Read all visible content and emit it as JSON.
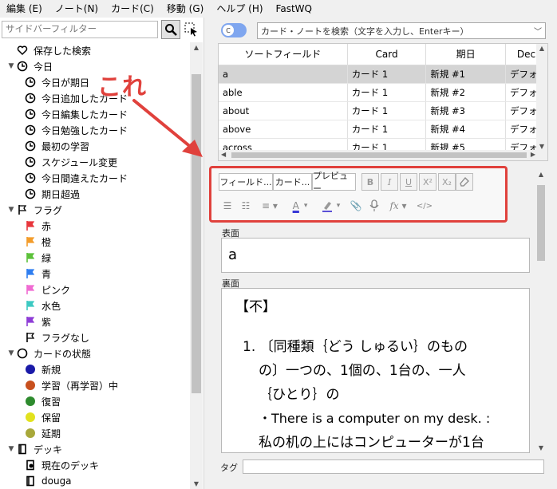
{
  "menu": [
    "編集 (E)",
    "ノート(N)",
    "カード(C)",
    "移動 (G)",
    "ヘルプ (H)",
    "FastWQ"
  ],
  "sidebar": {
    "filter_placeholder": "サイドバーフィルター",
    "items": [
      {
        "label": "保存した検索",
        "icon": "heart-icon"
      },
      {
        "label": "今日",
        "icon": "clock-icon"
      },
      {
        "label": "今日が期日",
        "icon": "clock-icon"
      },
      {
        "label": "今日追加したカード",
        "icon": "clock-icon"
      },
      {
        "label": "今日編集したカード",
        "icon": "clock-icon"
      },
      {
        "label": "今日勉強したカード",
        "icon": "clock-icon"
      },
      {
        "label": "最初の学習",
        "icon": "clock-icon"
      },
      {
        "label": "スケジュール変更",
        "icon": "clock-icon"
      },
      {
        "label": "今日間違えたカード",
        "icon": "clock-icon"
      },
      {
        "label": "期日超過",
        "icon": "clock-icon"
      },
      {
        "label": "フラグ",
        "icon": "flag-icon"
      },
      {
        "label": "赤",
        "icon": "flag-red-icon",
        "color": "#e8363c"
      },
      {
        "label": "橙",
        "icon": "flag-orange-icon",
        "color": "#f39c2a"
      },
      {
        "label": "緑",
        "icon": "flag-green-icon",
        "color": "#5cc13a"
      },
      {
        "label": "青",
        "icon": "flag-blue-icon",
        "color": "#2f7ef0"
      },
      {
        "label": "ピンク",
        "icon": "flag-pink-icon",
        "color": "#f06bd2"
      },
      {
        "label": "水色",
        "icon": "flag-turquoise-icon",
        "color": "#3cc9c2"
      },
      {
        "label": "紫",
        "icon": "flag-purple-icon",
        "color": "#8e3cd6"
      },
      {
        "label": "フラグなし",
        "icon": "flag-outline-icon"
      },
      {
        "label": "カードの状態",
        "icon": "circle-outline-icon"
      },
      {
        "label": "新規",
        "icon": "dot-icon",
        "color": "#1a1aa8"
      },
      {
        "label": "学習（再学習）中",
        "icon": "dot-icon",
        "color": "#c8501e"
      },
      {
        "label": "復習",
        "icon": "dot-icon",
        "color": "#2e8b2e"
      },
      {
        "label": "保留",
        "icon": "dot-icon",
        "color": "#e2e21e"
      },
      {
        "label": "延期",
        "icon": "dot-icon",
        "color": "#a8a83a"
      },
      {
        "label": "デッキ",
        "icon": "deck-icon"
      },
      {
        "label": "現在のデッキ",
        "icon": "deck-current-icon"
      },
      {
        "label": "douga",
        "icon": "deck-icon"
      }
    ]
  },
  "toggle_label": "C",
  "search": {
    "placeholder": "カード・ノートを検索（文字を入力し、Enterキー）"
  },
  "table": {
    "columns": [
      "ソートフィールド",
      "Card",
      "期日",
      "Dec"
    ],
    "rows": [
      [
        "a",
        "カード 1",
        "新規 #1",
        "デフォル"
      ],
      [
        "able",
        "カード 1",
        "新規 #2",
        "デフォル"
      ],
      [
        "about",
        "カード 1",
        "新規 #3",
        "デフォル"
      ],
      [
        "above",
        "カード 1",
        "新規 #4",
        "デフォル"
      ],
      [
        "across",
        "カード 1",
        "新規 #5",
        "デフォル"
      ]
    ]
  },
  "editor": {
    "fields_button": "フィールド...",
    "cards_button": "カード...",
    "preview_button": "プレビュー",
    "front_label": "表面",
    "front_value": "a",
    "back_label": "裏面",
    "back_lines": [
      "【不】",
      "1. 〔同種類｛どう しゅるい｝のもの",
      "の〕一つの、1個の、1台の、一人",
      "｛ひとり｝の",
      "・There is a computer on my desk. :",
      "私の机の上にはコンピューターが1台"
    ],
    "tags_label": "タグ"
  },
  "annotation": {
    "text": "これ",
    "color": "#e0413c"
  }
}
